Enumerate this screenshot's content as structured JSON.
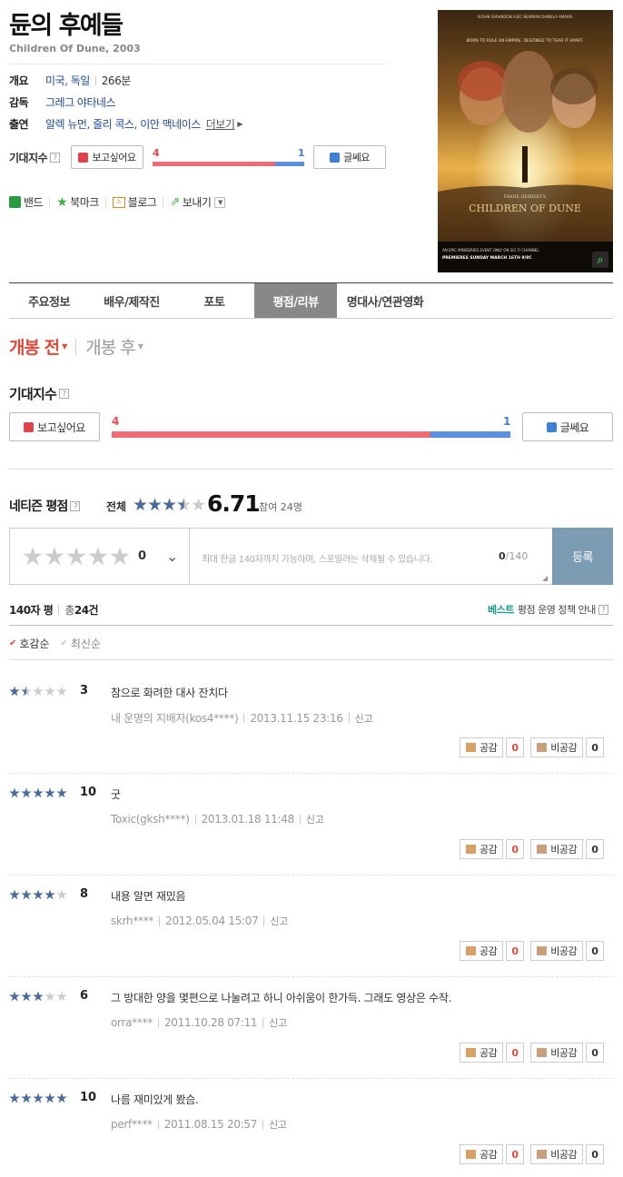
{
  "movie": {
    "title": "듄의 후예들",
    "subtitle": "Children Of Dune, 2003",
    "overview_label": "개요",
    "countries": "미국, 독일",
    "runtime": "266분",
    "director_label": "감독",
    "director": "그레그 야타네스",
    "cast_label": "출연",
    "cast": "알렉 뉴먼, 줄리 콕스, 이안 맥네이스",
    "more_label": "더보기",
    "poster_text": {
      "actors": "SUSAN SARANDON   ALEC NEWMAN   DANIELA AMAVIA",
      "tagline": "BORN TO RULE AN EMPIRE. DESTINED TO TEAR IT APART.",
      "brand": "FRANK HERBERT'S",
      "film_title": "CHILDREN OF DUNE",
      "footer1": "AN EPIC MINISERIES EVENT ONLY ON SCI FI CHANNEL",
      "footer2": "PREMIERES SUNDAY MARCH 16TH 9/8C"
    }
  },
  "expect": {
    "label": "기대지수",
    "want_label": "보고싶어요",
    "dontcare_label": "글쎄요",
    "want_count": 4,
    "dontcare_count": 1,
    "want_ratio": 0.8,
    "want_color": "#f06b74",
    "dontcare_color": "#5b8fe3"
  },
  "share": {
    "band": "밴드",
    "bookmark": "북마크",
    "blog": "블로그",
    "send": "보내기"
  },
  "tabs": [
    "주요정보",
    "배우/제작진",
    "포토",
    "평점/리뷰",
    "명대사/연관영화"
  ],
  "active_tab": "평점/리뷰",
  "period": {
    "before": "개봉 전",
    "after": "개봉 후"
  },
  "netizen": {
    "label": "네티즌 평점",
    "total_label": "전체",
    "score": "6.71",
    "score_value": 6.71,
    "participants": "참여 24명"
  },
  "input": {
    "score": "0",
    "placeholder": "최대 한글 140자까지 가능하며, 스포일러는 삭제될 수 있습니다.",
    "count": "0",
    "max": "/140",
    "register": "등록"
  },
  "list": {
    "type": "140자 평",
    "total_prefix": "총",
    "total_count": "24건",
    "best_label": "베스트",
    "policy_label": "평점 운영 정책 안내",
    "sort_like": "호감순",
    "sort_recent": "최신순"
  },
  "vote": {
    "like_label": "공감",
    "dislike_label": "비공감"
  },
  "reviews": [
    {
      "score": 3,
      "score_text": "3",
      "text": "참으로 화려한 대사 잔치다",
      "user": "내 운명의 지배자(kos4****)",
      "date": "2013.11.15 23:16",
      "report": "신고",
      "likes": "0",
      "dislikes": "0"
    },
    {
      "score": 10,
      "score_text": "10",
      "text": "굿",
      "user": "Toxic(gksh****)",
      "date": "2013.01.18 11:48",
      "report": "신고",
      "likes": "0",
      "dislikes": "0"
    },
    {
      "score": 8,
      "score_text": "8",
      "text": "내용 알면 재밌음",
      "user": "skrh****",
      "date": "2012.05.04 15:07",
      "report": "신고",
      "likes": "0",
      "dislikes": "0"
    },
    {
      "score": 6,
      "score_text": "6",
      "text": "그 방대한 양을 몇편으로 나눌려고 하니 아쉬움이 한가득. 그래도 영상은 수작.",
      "user": "orra****",
      "date": "2011.10.28 07:11",
      "report": "신고",
      "likes": "0",
      "dislikes": "0"
    },
    {
      "score": 10,
      "score_text": "10",
      "text": "나름 재미있게 봤슴.",
      "user": "perf****",
      "date": "2011.08.15 20:57",
      "report": "신고",
      "likes": "0",
      "dislikes": "0"
    }
  ]
}
